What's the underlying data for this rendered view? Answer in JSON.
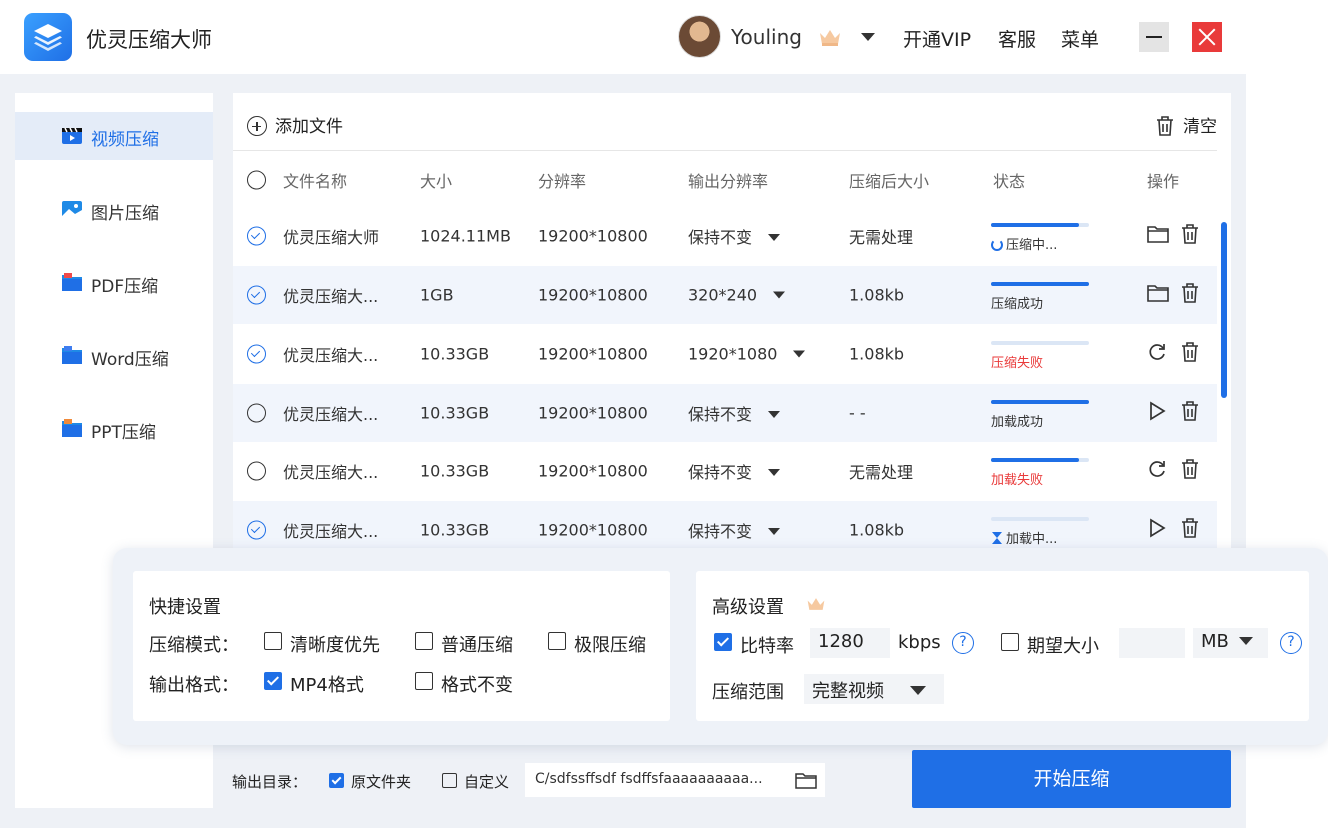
{
  "app": {
    "title": "优灵压缩大师",
    "username": "Youling",
    "vip_label": "开通VIP",
    "service_label": "客服",
    "menu_label": "菜单"
  },
  "sidebar": {
    "items": [
      {
        "label": "视频压缩",
        "active": true,
        "icon": "video-icon"
      },
      {
        "label": "图片压缩",
        "active": false,
        "icon": "image-icon"
      },
      {
        "label": "PDF压缩",
        "active": false,
        "icon": "pdf-icon"
      },
      {
        "label": "Word压缩",
        "active": false,
        "icon": "word-icon"
      },
      {
        "label": "PPT压缩",
        "active": false,
        "icon": "ppt-icon"
      }
    ]
  },
  "toolbar": {
    "add_file_label": "添加文件",
    "clear_label": "清空"
  },
  "table": {
    "headers": {
      "name": "文件名称",
      "size": "大小",
      "resolution": "分辨率",
      "output_resolution": "输出分辨率",
      "compressed_size": "压缩后大小",
      "status": "状态",
      "action": "操作"
    },
    "rows": [
      {
        "checked": true,
        "name": "优灵压缩大师",
        "size": "1024.11MB",
        "resolution": "19200*10800",
        "output_resolution": "保持不变",
        "compressed_size": "无需处理",
        "status": "压缩中...",
        "status_type": "progress",
        "progress": 0.9,
        "action": "open-folder"
      },
      {
        "checked": true,
        "name": "优灵压缩大...",
        "size": "1GB",
        "resolution": "19200*10800",
        "output_resolution": "320*240",
        "compressed_size": "1.08kb",
        "status": "压缩成功",
        "status_type": "success",
        "progress": 1.0,
        "action": "open-folder"
      },
      {
        "checked": true,
        "name": "优灵压缩大...",
        "size": "10.33GB",
        "resolution": "19200*10800",
        "output_resolution": "1920*1080",
        "compressed_size": "1.08kb",
        "status": "压缩失败",
        "status_type": "fail",
        "progress": 0.0,
        "action": "retry"
      },
      {
        "checked": false,
        "name": "优灵压缩大...",
        "size": "10.33GB",
        "resolution": "19200*10800",
        "output_resolution": "保持不变",
        "compressed_size": "- -",
        "status": "加载成功",
        "status_type": "success",
        "progress": 1.0,
        "action": "play"
      },
      {
        "checked": false,
        "name": "优灵压缩大...",
        "size": "10.33GB",
        "resolution": "19200*10800",
        "output_resolution": "保持不变",
        "compressed_size": "无需处理",
        "status": "加载失败",
        "status_type": "fail",
        "progress": 0.9,
        "action": "retry"
      },
      {
        "checked": true,
        "name": "优灵压缩大...",
        "size": "10.33GB",
        "resolution": "19200*10800",
        "output_resolution": "保持不变",
        "compressed_size": "1.08kb",
        "status": "加载中...",
        "status_type": "loading",
        "progress": 0.0,
        "action": "play"
      }
    ]
  },
  "quick_settings": {
    "title": "快捷设置",
    "mode_label": "压缩模式：",
    "mode_options": [
      {
        "label": "清晰度优先",
        "checked": false
      },
      {
        "label": "普通压缩",
        "checked": false
      },
      {
        "label": "极限压缩",
        "checked": false
      }
    ],
    "format_label": "输出格式：",
    "format_options": [
      {
        "label": "MP4格式",
        "checked": true
      },
      {
        "label": "格式不变",
        "checked": false
      }
    ]
  },
  "advanced_settings": {
    "title": "高级设置",
    "bitrate_label": "比特率",
    "bitrate_checked": true,
    "bitrate_value": "1280",
    "bitrate_unit": "kbps",
    "expected_size_label": "期望大小",
    "expected_size_checked": false,
    "expected_size_value": "",
    "expected_size_unit": "MB",
    "range_label": "压缩范围",
    "range_value": "完整视频"
  },
  "output": {
    "dir_label": "输出目录：",
    "original_folder_label": "原文件夹",
    "original_folder_checked": true,
    "custom_label": "自定义",
    "custom_checked": false,
    "path": "C/sdfssffsdf fsdffsfaaaaaaaaaa..."
  },
  "start_button_label": "开始压缩",
  "colors": {
    "accent": "#1f6fe6",
    "fail": "#e93a3a",
    "row_alt": "#f1f5fc",
    "background": "#eef1f6"
  }
}
